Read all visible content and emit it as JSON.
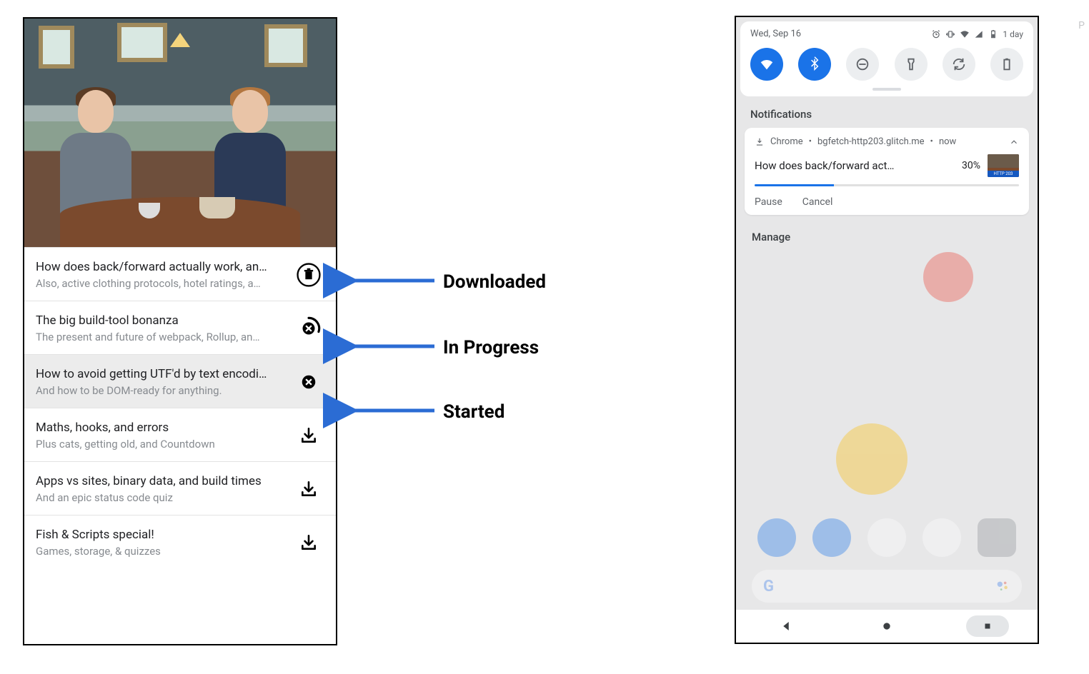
{
  "episodes": [
    {
      "title": "How does back/forward actually work, an…",
      "subtitle": "Also, active clothing protocols, hotel ratings, a…",
      "status": "downloaded"
    },
    {
      "title": "The big build-tool bonanza",
      "subtitle": "The present and future of webpack, Rollup, an…",
      "status": "in_progress"
    },
    {
      "title": "How to avoid getting UTF'd by text encodi…",
      "subtitle": "And how to be DOM-ready for anything.",
      "status": "started",
      "selected": true
    },
    {
      "title": "Maths, hooks, and errors",
      "subtitle": "Plus cats, getting old, and Countdown",
      "status": "not_started"
    },
    {
      "title": "Apps vs sites, binary data, and build times",
      "subtitle": "And an epic status code quiz",
      "status": "not_started"
    },
    {
      "title": "Fish & Scripts special!",
      "subtitle": "Games, storage, & quizzes",
      "status": "not_started"
    }
  ],
  "legend": {
    "downloaded": "Downloaded",
    "in_progress": "In Progress",
    "started": "Started"
  },
  "notification_panel": {
    "date": "Wed, Sep 16",
    "battery_text": "1 day",
    "section_label": "Notifications",
    "manage_label": "Manage",
    "toggles": [
      "wifi",
      "bluetooth",
      "dnd",
      "flashlight",
      "rotate",
      "battery"
    ]
  },
  "download_notification": {
    "app": "Chrome",
    "source": "bgfetch-http203.glitch.me",
    "time": "now",
    "title": "How does back/forward act…",
    "percent": "30%",
    "progress": 30,
    "thumb_label": "HTTP 203",
    "actions": {
      "pause": "Pause",
      "cancel": "Cancel"
    }
  },
  "side_char": "P"
}
